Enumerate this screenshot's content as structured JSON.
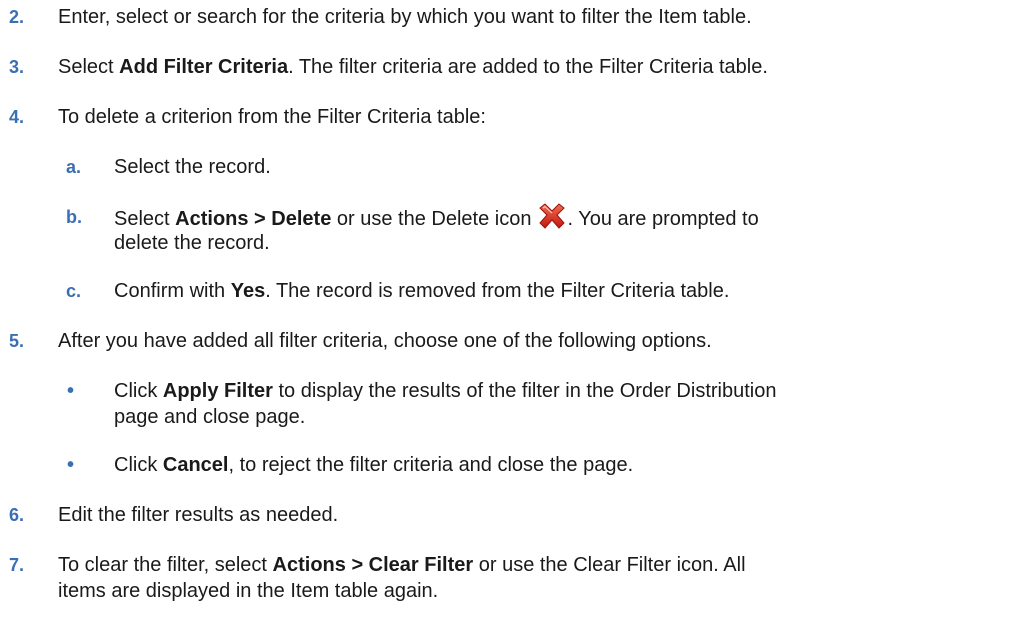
{
  "steps": [
    {
      "num": "2.",
      "text": "Enter, select or search for the criteria by which you want to filter the Item table."
    },
    {
      "num": "3.",
      "pre": "Select ",
      "bold": "Add Filter Criteria",
      "post": ". The filter criteria are added to the Filter Criteria table."
    },
    {
      "num": "4.",
      "text": "To delete a criterion from the Filter Criteria table:"
    },
    {
      "num": "5.",
      "text": "After you have added all filter criteria, choose one of the following options."
    },
    {
      "num": "6.",
      "text": "Edit the filter results as needed."
    },
    {
      "num": "7.",
      "pre": "To clear the filter, select ",
      "bold": "Actions > Clear Filter",
      "post": " or use the Clear Filter icon. All",
      "line2": "items are displayed in the Item table again."
    }
  ],
  "substeps": [
    {
      "letter": "a.",
      "text": "Select the record."
    },
    {
      "letter": "b.",
      "pre": "Select ",
      "bold": "Actions > Delete",
      "mid": " or use the Delete icon",
      "post": ". You are prompted to",
      "line2": "delete the record."
    },
    {
      "letter": "c.",
      "pre": "Confirm with ",
      "bold": "Yes",
      "post": ". The record is removed from the Filter Criteria table."
    }
  ],
  "bullets": [
    {
      "bullet": "•",
      "pre": "Click ",
      "bold": "Apply Filter",
      "post": " to display the results of the filter in the Order Distribution",
      "line2": "page and close page."
    },
    {
      "bullet": "•",
      "pre": "Click ",
      "bold": "Cancel",
      "post": ", to reject the filter criteria and close the page."
    }
  ],
  "icons": {
    "delete": "delete-x-icon",
    "delete_color": "#d9261c"
  }
}
